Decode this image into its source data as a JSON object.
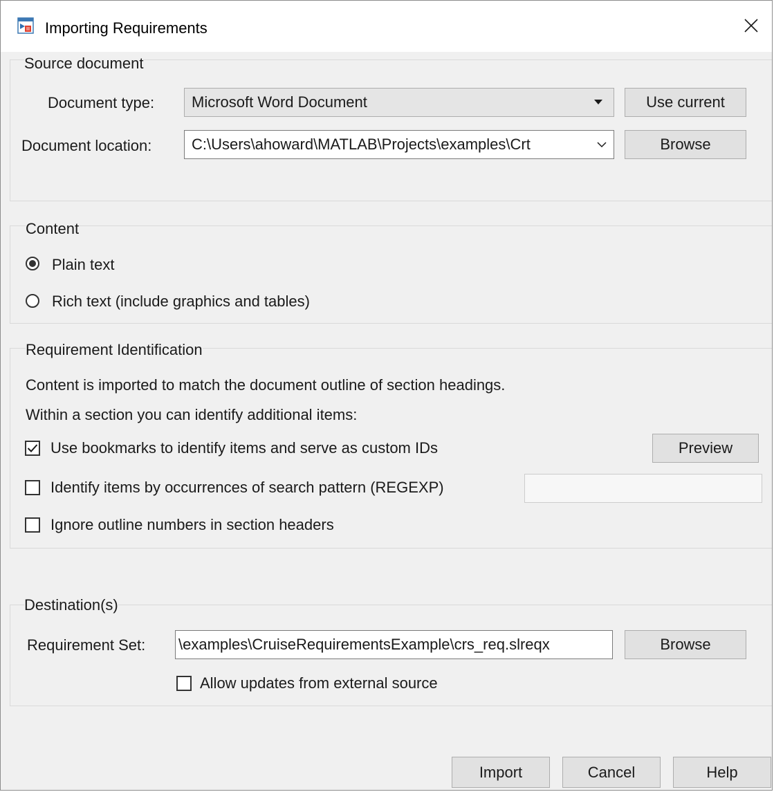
{
  "window": {
    "title": "Importing Requirements"
  },
  "source": {
    "title": "Source document",
    "doc_type_label": "Document type:",
    "doc_type_value": "Microsoft Word Document",
    "use_current_label": "Use current",
    "doc_location_label": "Document location:",
    "doc_location_value": "C:\\Users\\ahoward\\MATLAB\\Projects\\examples\\Crt",
    "browse_label": "Browse"
  },
  "content": {
    "title": "Content",
    "options": [
      {
        "label": "Plain text",
        "selected": true
      },
      {
        "label": "Rich text (include graphics and tables)",
        "selected": false
      }
    ]
  },
  "identification": {
    "title": "Requirement Identification",
    "line1": "Content is imported to match the document outline of section headings.",
    "line2": "Within a section you can identify additional items:",
    "options": [
      {
        "label": "Use bookmarks to identify items and serve as custom IDs",
        "checked": true
      },
      {
        "label": "Identify items by occurrences of search pattern (REGEXP)",
        "checked": false
      },
      {
        "label": "Ignore outline numbers in section headers",
        "checked": false
      }
    ],
    "preview_label": "Preview",
    "regexp_value": ""
  },
  "destination": {
    "title": "Destination(s)",
    "req_set_label": "Requirement Set:",
    "req_set_value": "\\examples\\CruiseRequirementsExample\\crs_req.slreqx",
    "browse_label": "Browse",
    "allow_updates_label": "Allow updates from external source",
    "allow_updates_checked": false
  },
  "footer": {
    "import_label": "Import",
    "cancel_label": "Cancel",
    "help_label": "Help"
  }
}
